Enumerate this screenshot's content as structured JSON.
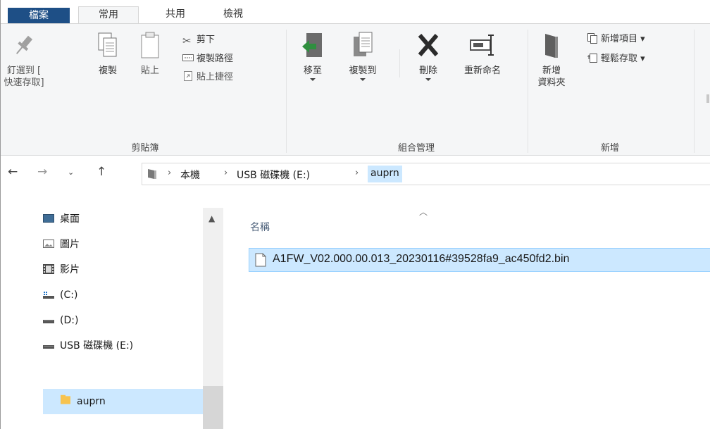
{
  "tabs": {
    "file": "檔案",
    "home": "常用",
    "share": "共用",
    "view": "檢視"
  },
  "ribbon": {
    "clipboard": {
      "pin_line1": "釘選到 [",
      "pin_line2": "快速存取]",
      "copy": "複製",
      "paste": "貼上",
      "cut": "剪下",
      "copy_path": "複製路徑",
      "paste_shortcut": "貼上捷徑",
      "group_label": "剪貼簿"
    },
    "organize": {
      "move_to": "移至",
      "copy_to": "複製到",
      "delete": "刪除",
      "rename": "重新命名",
      "group_label": "組合管理"
    },
    "new": {
      "new_folder_line1": "新增",
      "new_folder_line2": "資料夾",
      "new_item": "新增項目 ▾",
      "easy_access": "輕鬆存取 ▾",
      "group_label": "新增"
    }
  },
  "address": {
    "crumbs": [
      "本機",
      "USB 磁碟機 (E:)",
      "auprn"
    ],
    "sep": "›"
  },
  "nav_pane": {
    "items": [
      "桌面",
      "圖片",
      "影片",
      "(C:)",
      "(D:)",
      "USB 磁碟機 (E:)",
      "auprn"
    ],
    "selected": "auprn"
  },
  "content": {
    "column_name": "名稱",
    "files": [
      {
        "name": "A1FW_V02.000.00.013_20230116#39528fa9_ac450fd2.bin"
      }
    ]
  },
  "colors": {
    "file_tab": "#1e4f86",
    "selection": "#cce8ff",
    "selection_border": "#99d1ff",
    "accent_blue": "#1e73c8"
  },
  "icons": {
    "back": "arrow-left-icon",
    "forward": "arrow-right-icon",
    "recent": "chevron-down-icon",
    "up": "arrow-up-icon"
  }
}
